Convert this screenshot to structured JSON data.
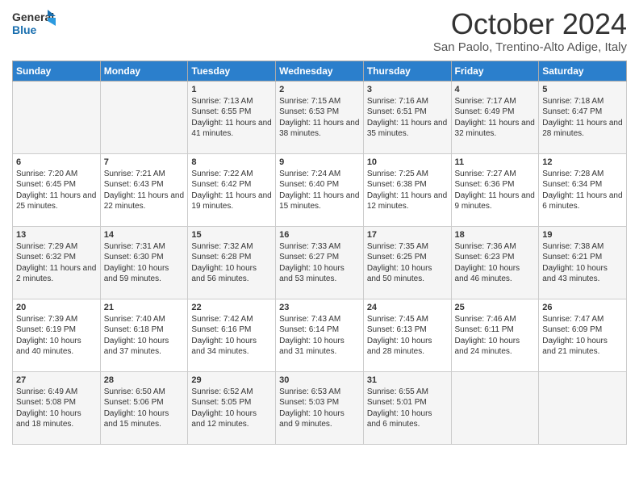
{
  "header": {
    "logo_line1": "General",
    "logo_line2": "Blue",
    "month": "October 2024",
    "location": "San Paolo, Trentino-Alto Adige, Italy"
  },
  "days_of_week": [
    "Sunday",
    "Monday",
    "Tuesday",
    "Wednesday",
    "Thursday",
    "Friday",
    "Saturday"
  ],
  "weeks": [
    [
      {
        "day": "",
        "content": ""
      },
      {
        "day": "",
        "content": ""
      },
      {
        "day": "1",
        "content": "Sunrise: 7:13 AM\nSunset: 6:55 PM\nDaylight: 11 hours and 41 minutes."
      },
      {
        "day": "2",
        "content": "Sunrise: 7:15 AM\nSunset: 6:53 PM\nDaylight: 11 hours and 38 minutes."
      },
      {
        "day": "3",
        "content": "Sunrise: 7:16 AM\nSunset: 6:51 PM\nDaylight: 11 hours and 35 minutes."
      },
      {
        "day": "4",
        "content": "Sunrise: 7:17 AM\nSunset: 6:49 PM\nDaylight: 11 hours and 32 minutes."
      },
      {
        "day": "5",
        "content": "Sunrise: 7:18 AM\nSunset: 6:47 PM\nDaylight: 11 hours and 28 minutes."
      }
    ],
    [
      {
        "day": "6",
        "content": "Sunrise: 7:20 AM\nSunset: 6:45 PM\nDaylight: 11 hours and 25 minutes."
      },
      {
        "day": "7",
        "content": "Sunrise: 7:21 AM\nSunset: 6:43 PM\nDaylight: 11 hours and 22 minutes."
      },
      {
        "day": "8",
        "content": "Sunrise: 7:22 AM\nSunset: 6:42 PM\nDaylight: 11 hours and 19 minutes."
      },
      {
        "day": "9",
        "content": "Sunrise: 7:24 AM\nSunset: 6:40 PM\nDaylight: 11 hours and 15 minutes."
      },
      {
        "day": "10",
        "content": "Sunrise: 7:25 AM\nSunset: 6:38 PM\nDaylight: 11 hours and 12 minutes."
      },
      {
        "day": "11",
        "content": "Sunrise: 7:27 AM\nSunset: 6:36 PM\nDaylight: 11 hours and 9 minutes."
      },
      {
        "day": "12",
        "content": "Sunrise: 7:28 AM\nSunset: 6:34 PM\nDaylight: 11 hours and 6 minutes."
      }
    ],
    [
      {
        "day": "13",
        "content": "Sunrise: 7:29 AM\nSunset: 6:32 PM\nDaylight: 11 hours and 2 minutes."
      },
      {
        "day": "14",
        "content": "Sunrise: 7:31 AM\nSunset: 6:30 PM\nDaylight: 10 hours and 59 minutes."
      },
      {
        "day": "15",
        "content": "Sunrise: 7:32 AM\nSunset: 6:28 PM\nDaylight: 10 hours and 56 minutes."
      },
      {
        "day": "16",
        "content": "Sunrise: 7:33 AM\nSunset: 6:27 PM\nDaylight: 10 hours and 53 minutes."
      },
      {
        "day": "17",
        "content": "Sunrise: 7:35 AM\nSunset: 6:25 PM\nDaylight: 10 hours and 50 minutes."
      },
      {
        "day": "18",
        "content": "Sunrise: 7:36 AM\nSunset: 6:23 PM\nDaylight: 10 hours and 46 minutes."
      },
      {
        "day": "19",
        "content": "Sunrise: 7:38 AM\nSunset: 6:21 PM\nDaylight: 10 hours and 43 minutes."
      }
    ],
    [
      {
        "day": "20",
        "content": "Sunrise: 7:39 AM\nSunset: 6:19 PM\nDaylight: 10 hours and 40 minutes."
      },
      {
        "day": "21",
        "content": "Sunrise: 7:40 AM\nSunset: 6:18 PM\nDaylight: 10 hours and 37 minutes."
      },
      {
        "day": "22",
        "content": "Sunrise: 7:42 AM\nSunset: 6:16 PM\nDaylight: 10 hours and 34 minutes."
      },
      {
        "day": "23",
        "content": "Sunrise: 7:43 AM\nSunset: 6:14 PM\nDaylight: 10 hours and 31 minutes."
      },
      {
        "day": "24",
        "content": "Sunrise: 7:45 AM\nSunset: 6:13 PM\nDaylight: 10 hours and 28 minutes."
      },
      {
        "day": "25",
        "content": "Sunrise: 7:46 AM\nSunset: 6:11 PM\nDaylight: 10 hours and 24 minutes."
      },
      {
        "day": "26",
        "content": "Sunrise: 7:47 AM\nSunset: 6:09 PM\nDaylight: 10 hours and 21 minutes."
      }
    ],
    [
      {
        "day": "27",
        "content": "Sunrise: 6:49 AM\nSunset: 5:08 PM\nDaylight: 10 hours and 18 minutes."
      },
      {
        "day": "28",
        "content": "Sunrise: 6:50 AM\nSunset: 5:06 PM\nDaylight: 10 hours and 15 minutes."
      },
      {
        "day": "29",
        "content": "Sunrise: 6:52 AM\nSunset: 5:05 PM\nDaylight: 10 hours and 12 minutes."
      },
      {
        "day": "30",
        "content": "Sunrise: 6:53 AM\nSunset: 5:03 PM\nDaylight: 10 hours and 9 minutes."
      },
      {
        "day": "31",
        "content": "Sunrise: 6:55 AM\nSunset: 5:01 PM\nDaylight: 10 hours and 6 minutes."
      },
      {
        "day": "",
        "content": ""
      },
      {
        "day": "",
        "content": ""
      }
    ]
  ]
}
